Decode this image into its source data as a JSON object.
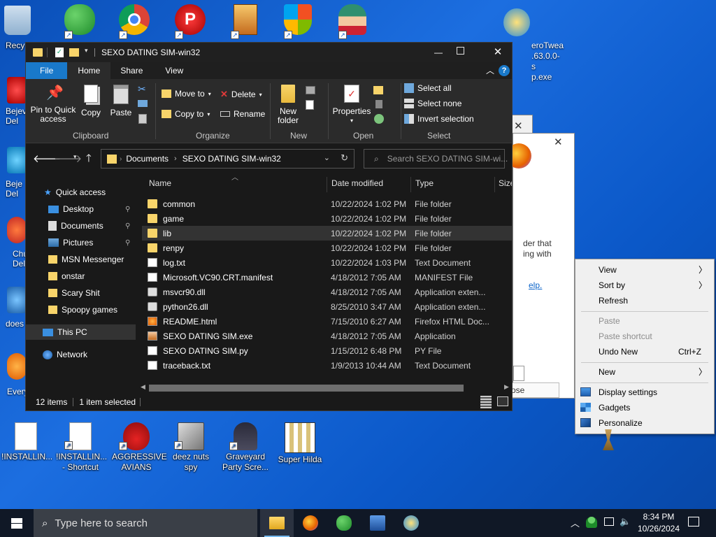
{
  "desktop": {
    "icons_left_partial": [
      {
        "label": "Recy"
      },
      {
        "label": "Bejev\nDel"
      },
      {
        "label": "Beje\nDel"
      },
      {
        "label": "Chu\nDel"
      },
      {
        "label": "does"
      },
      {
        "label": "Every"
      }
    ],
    "icons_right_partial": {
      "line1": "eroTwea",
      "line2": ".63.0.0-s",
      "line3": "p.exe"
    },
    "icons_bottom": [
      {
        "label": "!INSTALLIN...",
        "icon": "document-icon"
      },
      {
        "label": "!INSTALLIN... - Shortcut",
        "icon": "document-icon"
      },
      {
        "label": "AGGRESSIVE AVIANS",
        "icon": "angry-bird-icon"
      },
      {
        "label": "deez nuts spy",
        "icon": "windows-stack-icon"
      },
      {
        "label": "Graveyard Party Scre...",
        "icon": "graveyard-icon"
      },
      {
        "label": "Super Hilda",
        "icon": "pixel-art-icon"
      }
    ]
  },
  "bg_window": {
    "text_line1": "der that",
    "text_line2": "ing with",
    "link": "elp.",
    "button": "ose"
  },
  "explorer": {
    "title": "SEXO DATING SIM-win32",
    "tabs": [
      "File",
      "Home",
      "Share",
      "View"
    ],
    "ribbon": {
      "clipboard": {
        "pin": "Pin to Quick access",
        "copy": "Copy",
        "paste": "Paste",
        "label": "Clipboard"
      },
      "organize": {
        "move_to": "Move to",
        "copy_to": "Copy to",
        "delete": "Delete",
        "rename": "Rename",
        "label": "Organize"
      },
      "new": {
        "new_folder": "New folder",
        "label": "New"
      },
      "open": {
        "properties": "Properties",
        "label": "Open"
      },
      "select": {
        "select_all": "Select all",
        "select_none": "Select none",
        "invert": "Invert selection",
        "label": "Select"
      }
    },
    "address": {
      "crumb1": "Documents",
      "crumb2": "SEXO DATING SIM-win32"
    },
    "search_placeholder": "Search SEXO DATING SIM-wi...",
    "nav": {
      "quick_access": "Quick access",
      "items": [
        "Desktop",
        "Documents",
        "Pictures",
        "MSN Messenger",
        "onstar",
        "Scary Shit",
        "Spoopy games"
      ],
      "this_pc": "This PC",
      "network": "Network"
    },
    "columns": {
      "name": "Name",
      "date": "Date modified",
      "type": "Type",
      "size": "Size"
    },
    "files": [
      {
        "name": "common",
        "date": "10/22/2024 1:02 PM",
        "type": "File folder",
        "icon": "folder-icon"
      },
      {
        "name": "game",
        "date": "10/22/2024 1:02 PM",
        "type": "File folder",
        "icon": "folder-icon"
      },
      {
        "name": "lib",
        "date": "10/22/2024 1:02 PM",
        "type": "File folder",
        "icon": "folder-icon"
      },
      {
        "name": "renpy",
        "date": "10/22/2024 1:02 PM",
        "type": "File folder",
        "icon": "folder-icon"
      },
      {
        "name": "log.txt",
        "date": "10/22/2024 1:03 PM",
        "type": "Text Document",
        "icon": "text-file-icon"
      },
      {
        "name": "Microsoft.VC90.CRT.manifest",
        "date": "4/18/2012 7:05 AM",
        "type": "MANIFEST File",
        "icon": "file-icon"
      },
      {
        "name": "msvcr90.dll",
        "date": "4/18/2012 7:05 AM",
        "type": "Application exten...",
        "icon": "dll-icon"
      },
      {
        "name": "python26.dll",
        "date": "8/25/2010 3:47 AM",
        "type": "Application exten...",
        "icon": "dll-icon"
      },
      {
        "name": "README.html",
        "date": "7/15/2010 6:27 AM",
        "type": "Firefox HTML Doc...",
        "icon": "html-file-icon"
      },
      {
        "name": "SEXO DATING SIM.exe",
        "date": "4/18/2012 7:05 AM",
        "type": "Application",
        "icon": "exe-icon"
      },
      {
        "name": "SEXO DATING SIM.py",
        "date": "1/15/2012 6:48 PM",
        "type": "PY File",
        "icon": "file-icon"
      },
      {
        "name": "traceback.txt",
        "date": "1/9/2013 10:44 AM",
        "type": "Text Document",
        "icon": "text-file-icon"
      }
    ],
    "status": {
      "count": "12 items",
      "selected": "1 item selected"
    }
  },
  "context_menu": {
    "view": "View",
    "sort_by": "Sort by",
    "refresh": "Refresh",
    "paste": "Paste",
    "paste_shortcut": "Paste shortcut",
    "undo_new": "Undo New",
    "undo_accel": "Ctrl+Z",
    "new": "New",
    "display_settings": "Display settings",
    "gadgets": "Gadgets",
    "personalize": "Personalize"
  },
  "taskbar": {
    "search_placeholder": "Type here to search",
    "time": "8:34 PM",
    "date": "10/26/2024"
  },
  "colors": {
    "accent": "#1979ca",
    "desktop": "#0b58c8",
    "dark_bg": "#191919"
  }
}
